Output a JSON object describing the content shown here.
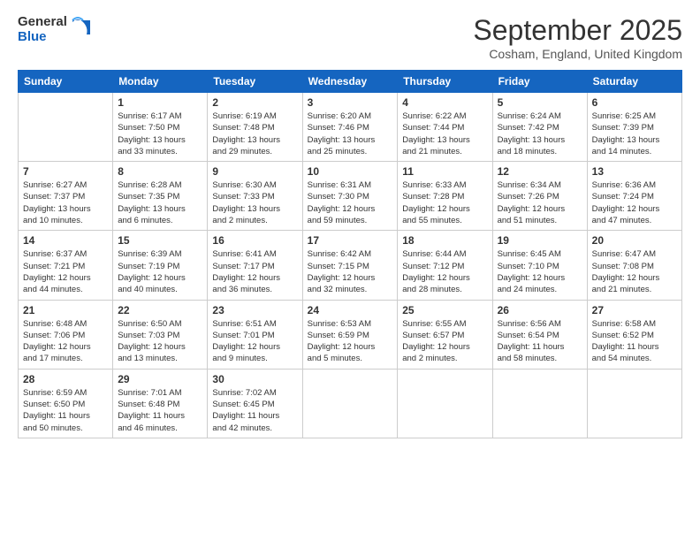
{
  "logo": {
    "general": "General",
    "blue": "Blue"
  },
  "header": {
    "month": "September 2025",
    "location": "Cosham, England, United Kingdom"
  },
  "days_of_week": [
    "Sunday",
    "Monday",
    "Tuesday",
    "Wednesday",
    "Thursday",
    "Friday",
    "Saturday"
  ],
  "weeks": [
    [
      {
        "day": "",
        "info": ""
      },
      {
        "day": "1",
        "info": "Sunrise: 6:17 AM\nSunset: 7:50 PM\nDaylight: 13 hours\nand 33 minutes."
      },
      {
        "day": "2",
        "info": "Sunrise: 6:19 AM\nSunset: 7:48 PM\nDaylight: 13 hours\nand 29 minutes."
      },
      {
        "day": "3",
        "info": "Sunrise: 6:20 AM\nSunset: 7:46 PM\nDaylight: 13 hours\nand 25 minutes."
      },
      {
        "day": "4",
        "info": "Sunrise: 6:22 AM\nSunset: 7:44 PM\nDaylight: 13 hours\nand 21 minutes."
      },
      {
        "day": "5",
        "info": "Sunrise: 6:24 AM\nSunset: 7:42 PM\nDaylight: 13 hours\nand 18 minutes."
      },
      {
        "day": "6",
        "info": "Sunrise: 6:25 AM\nSunset: 7:39 PM\nDaylight: 13 hours\nand 14 minutes."
      }
    ],
    [
      {
        "day": "7",
        "info": "Sunrise: 6:27 AM\nSunset: 7:37 PM\nDaylight: 13 hours\nand 10 minutes."
      },
      {
        "day": "8",
        "info": "Sunrise: 6:28 AM\nSunset: 7:35 PM\nDaylight: 13 hours\nand 6 minutes."
      },
      {
        "day": "9",
        "info": "Sunrise: 6:30 AM\nSunset: 7:33 PM\nDaylight: 13 hours\nand 2 minutes."
      },
      {
        "day": "10",
        "info": "Sunrise: 6:31 AM\nSunset: 7:30 PM\nDaylight: 12 hours\nand 59 minutes."
      },
      {
        "day": "11",
        "info": "Sunrise: 6:33 AM\nSunset: 7:28 PM\nDaylight: 12 hours\nand 55 minutes."
      },
      {
        "day": "12",
        "info": "Sunrise: 6:34 AM\nSunset: 7:26 PM\nDaylight: 12 hours\nand 51 minutes."
      },
      {
        "day": "13",
        "info": "Sunrise: 6:36 AM\nSunset: 7:24 PM\nDaylight: 12 hours\nand 47 minutes."
      }
    ],
    [
      {
        "day": "14",
        "info": "Sunrise: 6:37 AM\nSunset: 7:21 PM\nDaylight: 12 hours\nand 44 minutes."
      },
      {
        "day": "15",
        "info": "Sunrise: 6:39 AM\nSunset: 7:19 PM\nDaylight: 12 hours\nand 40 minutes."
      },
      {
        "day": "16",
        "info": "Sunrise: 6:41 AM\nSunset: 7:17 PM\nDaylight: 12 hours\nand 36 minutes."
      },
      {
        "day": "17",
        "info": "Sunrise: 6:42 AM\nSunset: 7:15 PM\nDaylight: 12 hours\nand 32 minutes."
      },
      {
        "day": "18",
        "info": "Sunrise: 6:44 AM\nSunset: 7:12 PM\nDaylight: 12 hours\nand 28 minutes."
      },
      {
        "day": "19",
        "info": "Sunrise: 6:45 AM\nSunset: 7:10 PM\nDaylight: 12 hours\nand 24 minutes."
      },
      {
        "day": "20",
        "info": "Sunrise: 6:47 AM\nSunset: 7:08 PM\nDaylight: 12 hours\nand 21 minutes."
      }
    ],
    [
      {
        "day": "21",
        "info": "Sunrise: 6:48 AM\nSunset: 7:06 PM\nDaylight: 12 hours\nand 17 minutes."
      },
      {
        "day": "22",
        "info": "Sunrise: 6:50 AM\nSunset: 7:03 PM\nDaylight: 12 hours\nand 13 minutes."
      },
      {
        "day": "23",
        "info": "Sunrise: 6:51 AM\nSunset: 7:01 PM\nDaylight: 12 hours\nand 9 minutes."
      },
      {
        "day": "24",
        "info": "Sunrise: 6:53 AM\nSunset: 6:59 PM\nDaylight: 12 hours\nand 5 minutes."
      },
      {
        "day": "25",
        "info": "Sunrise: 6:55 AM\nSunset: 6:57 PM\nDaylight: 12 hours\nand 2 minutes."
      },
      {
        "day": "26",
        "info": "Sunrise: 6:56 AM\nSunset: 6:54 PM\nDaylight: 11 hours\nand 58 minutes."
      },
      {
        "day": "27",
        "info": "Sunrise: 6:58 AM\nSunset: 6:52 PM\nDaylight: 11 hours\nand 54 minutes."
      }
    ],
    [
      {
        "day": "28",
        "info": "Sunrise: 6:59 AM\nSunset: 6:50 PM\nDaylight: 11 hours\nand 50 minutes."
      },
      {
        "day": "29",
        "info": "Sunrise: 7:01 AM\nSunset: 6:48 PM\nDaylight: 11 hours\nand 46 minutes."
      },
      {
        "day": "30",
        "info": "Sunrise: 7:02 AM\nSunset: 6:45 PM\nDaylight: 11 hours\nand 42 minutes."
      },
      {
        "day": "",
        "info": ""
      },
      {
        "day": "",
        "info": ""
      },
      {
        "day": "",
        "info": ""
      },
      {
        "day": "",
        "info": ""
      }
    ]
  ]
}
